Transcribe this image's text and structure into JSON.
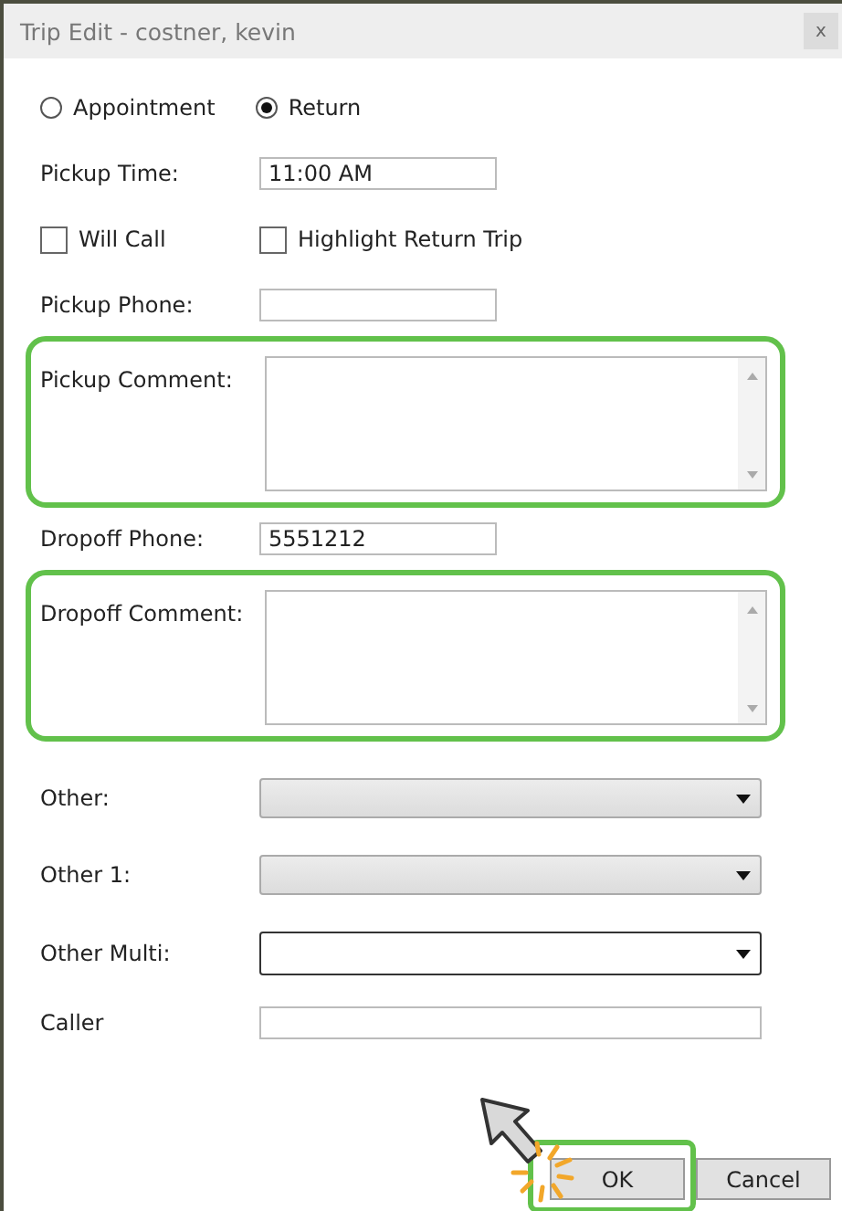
{
  "window": {
    "title": "Trip Edit - costner, kevin",
    "close": "x"
  },
  "trip_type": [
    {
      "label": "Appointment",
      "selected": false
    },
    {
      "label": "Return",
      "selected": true
    }
  ],
  "fields": [
    {
      "kind": "text",
      "label": "Pickup Time:",
      "value": "11:00 AM"
    },
    {
      "kind": "checks",
      "items": [
        {
          "label": "Will Call",
          "checked": false
        },
        {
          "label": "Highlight Return Trip",
          "checked": false
        }
      ]
    },
    {
      "kind": "text",
      "label": "Pickup Phone:"
    },
    {
      "kind": "memo",
      "label": "Pickup Comment:",
      "highlighted": true
    },
    {
      "kind": "text",
      "label": "Dropoff Phone:",
      "value": "5551212"
    },
    {
      "kind": "memo",
      "label": "Dropoff Comment:",
      "highlighted": true
    },
    {
      "kind": "combo",
      "label": "Other:",
      "focused": false
    },
    {
      "kind": "combo",
      "label": "Other 1:",
      "focused": false
    },
    {
      "kind": "combo",
      "label": "Other Multi:",
      "focused": true
    },
    {
      "kind": "line",
      "label": "Caller"
    }
  ],
  "buttons": [
    {
      "label": "OK",
      "highlighted": true,
      "clicked": true
    },
    {
      "label": "Cancel",
      "highlighted": false,
      "clicked": false
    }
  ]
}
